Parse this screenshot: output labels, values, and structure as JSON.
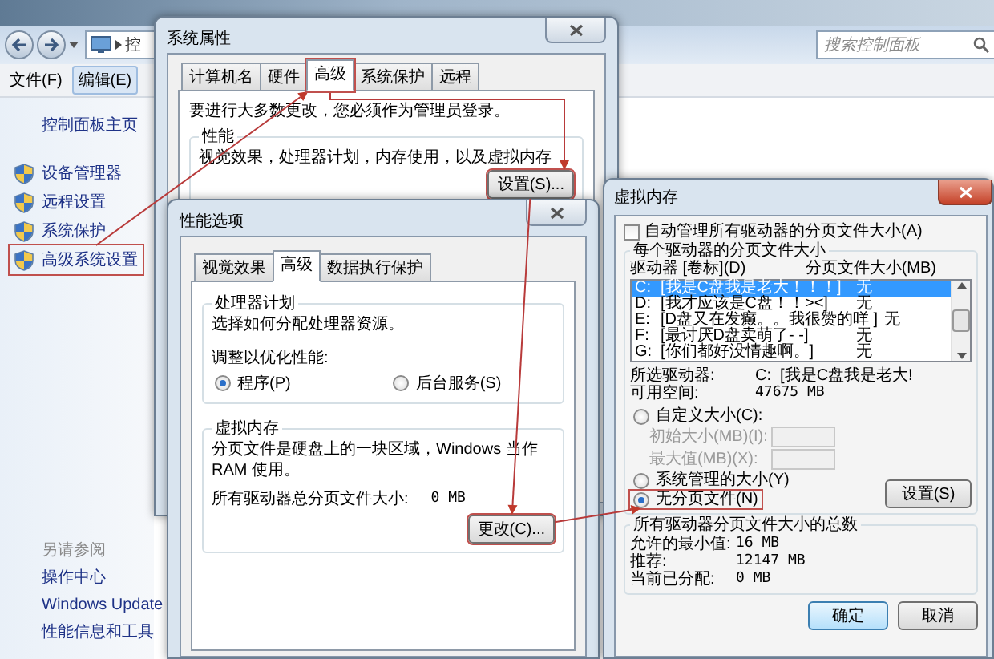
{
  "explorer": {
    "address": "控",
    "search": {
      "placeholder": "搜索控制面板"
    },
    "menu": [
      {
        "label": "文件(F)",
        "selected": false
      },
      {
        "label": "编辑(E)",
        "selected": true
      }
    ],
    "sidebar": {
      "home": "控制面板主页",
      "items": [
        {
          "label": "设备管理器",
          "highlighted": false
        },
        {
          "label": "远程设置",
          "highlighted": false
        },
        {
          "label": "系统保护",
          "highlighted": false
        },
        {
          "label": "高级系统设置",
          "highlighted": true
        }
      ],
      "see_also": {
        "title": "另请参阅",
        "items": [
          "操作中心",
          "Windows Update",
          "性能信息和工具"
        ]
      }
    }
  },
  "system_properties": {
    "title": "系统属性",
    "tabs": [
      {
        "label": "计算机名",
        "selected": false,
        "highlighted": false
      },
      {
        "label": "硬件",
        "selected": false,
        "highlighted": false
      },
      {
        "label": "高级",
        "selected": true,
        "highlighted": true
      },
      {
        "label": "系统保护",
        "selected": false,
        "highlighted": false
      },
      {
        "label": "远程",
        "selected": false,
        "highlighted": false
      }
    ],
    "notice": "要进行大多数更改，您必须作为管理员登录。",
    "performance": {
      "title": "性能",
      "text": "视觉效果，处理器计划，内存使用，以及虚拟内存",
      "button": {
        "label": "设置(S)...",
        "highlighted": true
      }
    }
  },
  "performance_options": {
    "title": "性能选项",
    "tabs": [
      {
        "label": "视觉效果",
        "selected": false
      },
      {
        "label": "高级",
        "selected": true
      },
      {
        "label": "数据执行保护",
        "selected": false
      }
    ],
    "processor": {
      "title": "处理器计划",
      "text": "选择如何分配处理器资源。",
      "prompt": "调整以优化性能:",
      "options": [
        {
          "label": "程序(P)",
          "selected": true
        },
        {
          "label": "后台服务(S)",
          "selected": false
        }
      ]
    },
    "virtual_memory": {
      "title": "虚拟内存",
      "text": "分页文件是硬盘上的一块区域，Windows 当作 RAM 使用。",
      "total_label": "所有驱动器总分页文件大小:",
      "total_value": "0 MB",
      "button": {
        "label": "更改(C)...",
        "highlighted": true
      }
    }
  },
  "virtual_memory": {
    "title": "虚拟内存",
    "auto_manage": {
      "label": "自动管理所有驱动器的分页文件大小(A)",
      "checked": false
    },
    "drives": {
      "title": "每个驱动器的分页文件大小",
      "columns": [
        "驱动器 [卷标](D)",
        "分页文件大小(MB)"
      ],
      "rows": [
        {
          "drive": "C:",
          "volume": "[我是C盘我是老大！！！]",
          "size": "无",
          "selected": true
        },
        {
          "drive": "D:",
          "volume": "[我才应该是C盘！！><]",
          "size": "无",
          "selected": false
        },
        {
          "drive": "E:",
          "volume": "[D盘又在发癫。。我很赞的咩 ]",
          "size": "无",
          "selected": false
        },
        {
          "drive": "F:",
          "volume": "[最讨厌D盘卖萌了- -]",
          "size": "无",
          "selected": false
        },
        {
          "drive": "G:",
          "volume": "[你们都好没情趣啊。]",
          "size": "无",
          "selected": false
        }
      ],
      "selected_drive": {
        "label": "所选驱动器:",
        "drive": "C:",
        "volume": "[我是C盘我是老大!"
      },
      "free_space": {
        "label": "可用空间:",
        "value": "47675 MB"
      },
      "size_options": [
        {
          "kind": "radio",
          "label": "自定义大小(C):",
          "selected": false,
          "highlighted": false
        },
        {
          "kind": "field",
          "label": "初始大小(MB)(I):",
          "disabled": true
        },
        {
          "kind": "field",
          "label": "最大值(MB)(X):",
          "disabled": true
        },
        {
          "kind": "radio",
          "label": "系统管理的大小(Y)",
          "selected": false,
          "highlighted": false
        },
        {
          "kind": "radio",
          "label": "无分页文件(N)",
          "selected": true,
          "highlighted": true
        }
      ],
      "set_button": "设置(S)"
    },
    "totals": {
      "title": "所有驱动器分页文件大小的总数",
      "rows": [
        {
          "label": "允许的最小值:",
          "value": "16 MB"
        },
        {
          "label": "推荐:",
          "value": "12147 MB"
        },
        {
          "label": "当前已分配:",
          "value": "0 MB"
        }
      ]
    },
    "buttons": [
      {
        "label": "确定",
        "default": true
      },
      {
        "label": "取消",
        "default": false
      }
    ]
  }
}
